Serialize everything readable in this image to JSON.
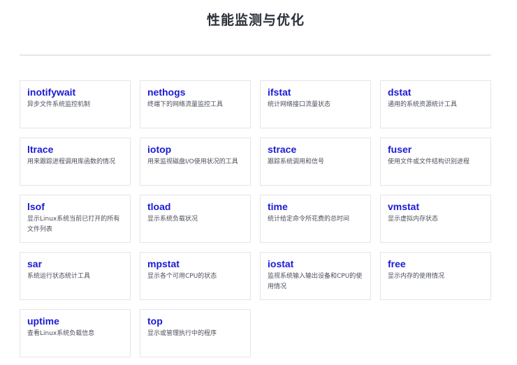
{
  "header": {
    "title": "性能监测与优化"
  },
  "tools": [
    {
      "name": "inotifywait",
      "desc": "异步文件系统监控机制"
    },
    {
      "name": "nethogs",
      "desc": "终端下的网络流量监控工具"
    },
    {
      "name": "ifstat",
      "desc": "统计网络接口流量状态"
    },
    {
      "name": "dstat",
      "desc": "通用的系统资源统计工具"
    },
    {
      "name": "ltrace",
      "desc": "用来跟踪进程调用库函数的情况"
    },
    {
      "name": "iotop",
      "desc": "用来监视磁盘I/O使用状况的工具"
    },
    {
      "name": "strace",
      "desc": "跟踪系统调用和信号"
    },
    {
      "name": "fuser",
      "desc": "使用文件或文件结构识别进程"
    },
    {
      "name": "lsof",
      "desc": "显示Linux系统当前已打开的所有文件列表"
    },
    {
      "name": "tload",
      "desc": "显示系统负载状况"
    },
    {
      "name": "time",
      "desc": "统计给定命令所花费的总时间"
    },
    {
      "name": "vmstat",
      "desc": "显示虚拟内存状态"
    },
    {
      "name": "sar",
      "desc": "系统运行状态统计工具"
    },
    {
      "name": "mpstat",
      "desc": "显示各个可用CPU的状态"
    },
    {
      "name": "iostat",
      "desc": "监视系统输入输出设备和CPU的使用情况"
    },
    {
      "name": "free",
      "desc": "显示内存的使用情况"
    },
    {
      "name": "uptime",
      "desc": "查看Linux系统负载信息"
    },
    {
      "name": "top",
      "desc": "显示或管理执行中的程序"
    }
  ]
}
